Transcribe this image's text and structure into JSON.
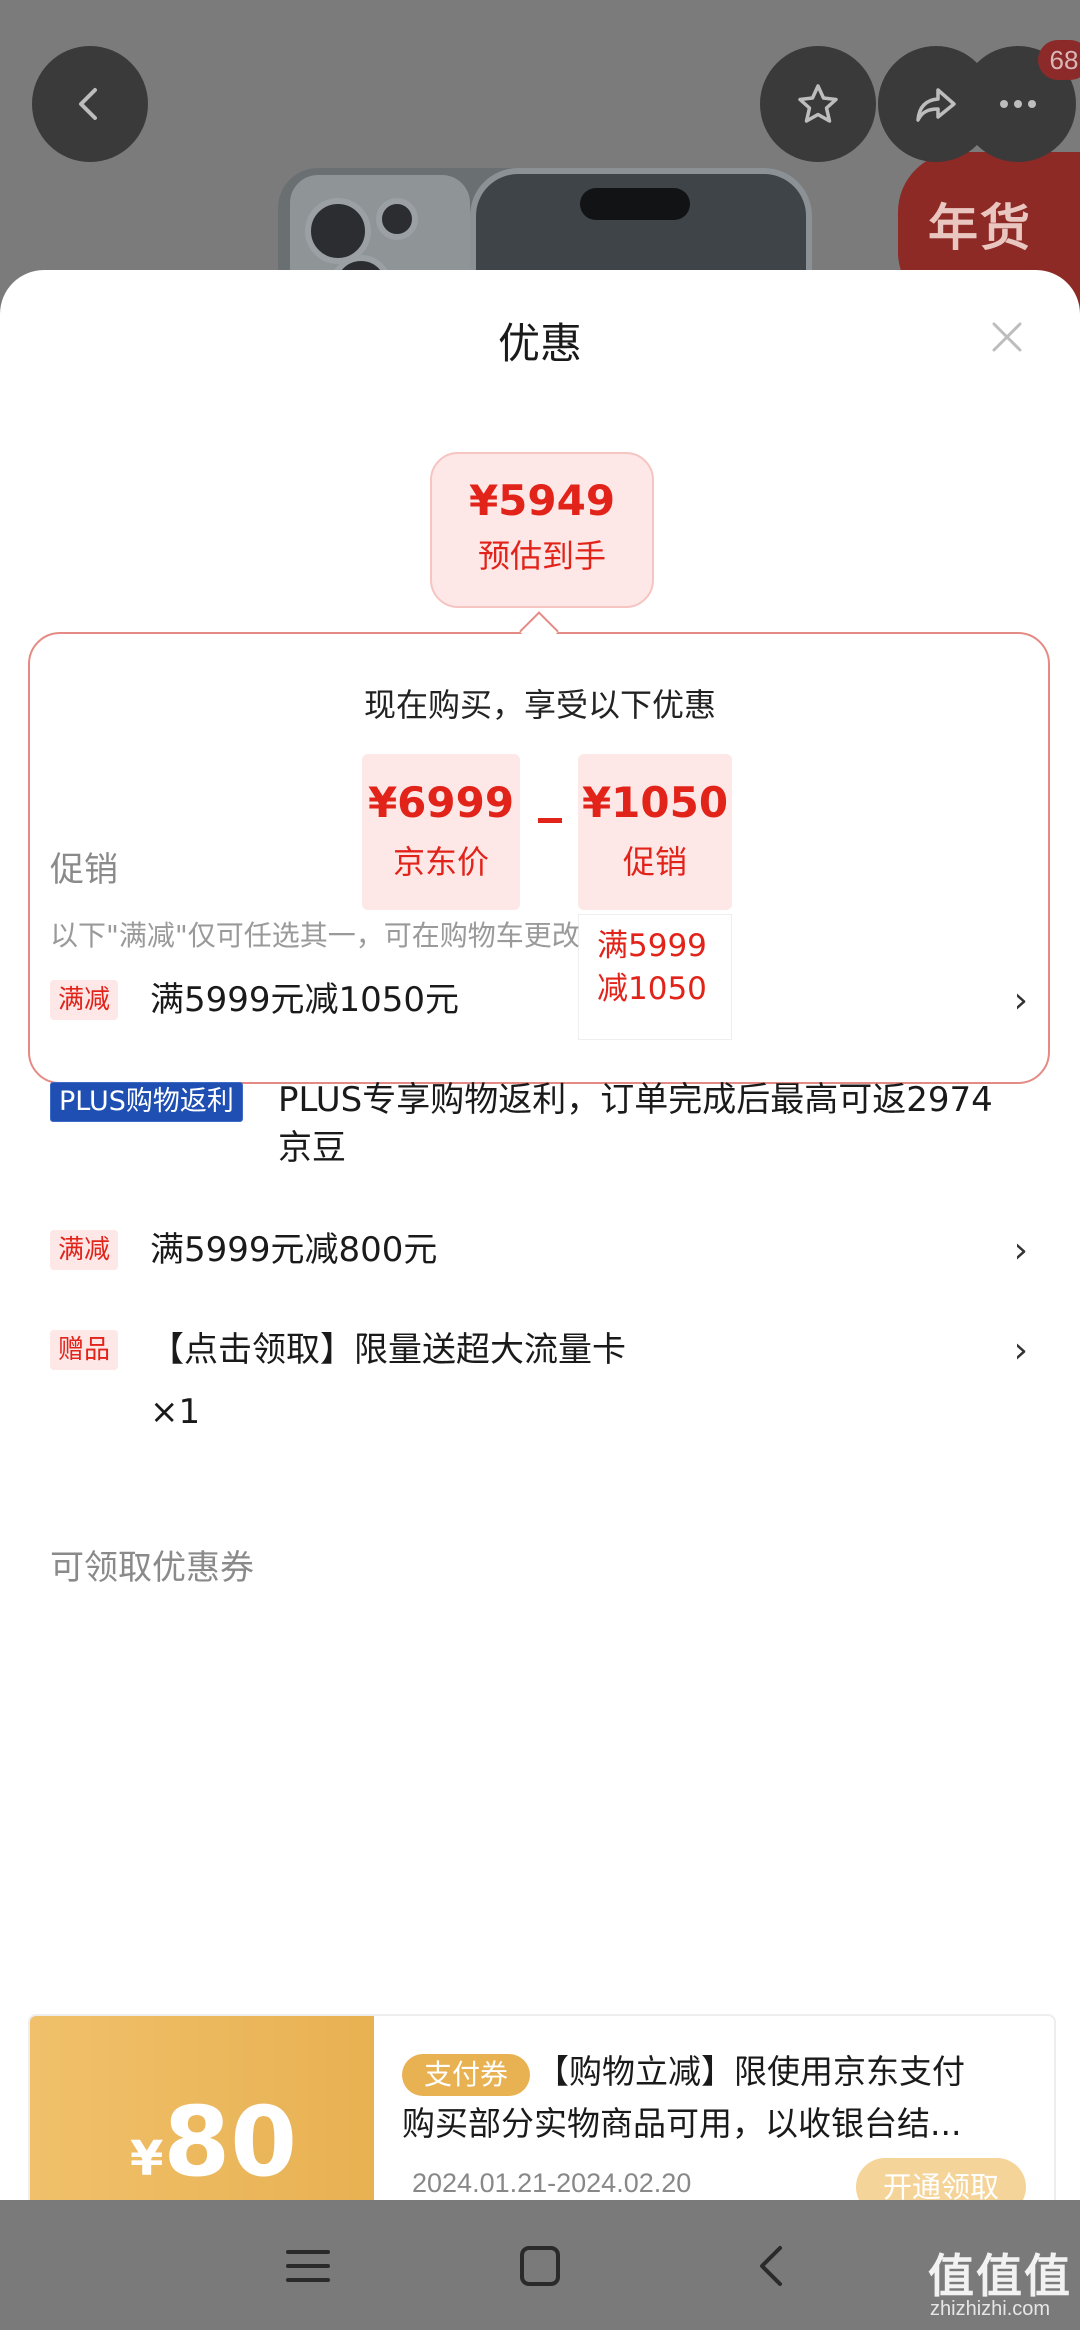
{
  "top_bar": {
    "cart_badge": "68"
  },
  "background": {
    "promo_badge": "年货节"
  },
  "sheet": {
    "title": "优惠",
    "estimate": {
      "price": "¥5949",
      "label": "预估到手"
    },
    "calc": {
      "heading": "现在购买，享受以下优惠",
      "jd_price": {
        "value": "¥6999",
        "label": "京东价"
      },
      "promo": {
        "value": "¥1050",
        "label": "促销"
      },
      "rule_line1": "满5999",
      "rule_line2": "减1050"
    },
    "promotions": {
      "title": "促销",
      "subtitle": "以下\"满减\"仅可任选其一，可在购物车更改",
      "items": [
        {
          "tag": "满减",
          "text": "满5999元减1050元"
        },
        {
          "tag": "PLUS购物返利",
          "text_line1": "PLUS专享购物返利，订单完成后最高可返2974",
          "text_line2": "京豆"
        },
        {
          "tag": "满减",
          "text": "满5999元减800元"
        },
        {
          "tag": "赠品",
          "text": "【点击领取】限量送超大流量卡",
          "qty": "×1"
        }
      ]
    },
    "coupons": {
      "title": "可领取优惠券",
      "items": [
        {
          "currency": "¥",
          "amount": "80",
          "tag": "支付券",
          "line1": "【购物立减】限使用京东支付",
          "line2": "购买部分实物商品可用，以收银台结...",
          "date": "2024.01.21-2024.02.20",
          "button": "开通领取"
        }
      ]
    }
  },
  "watermark": {
    "main": "值值值",
    "sub": "zhizhizhi.com"
  }
}
